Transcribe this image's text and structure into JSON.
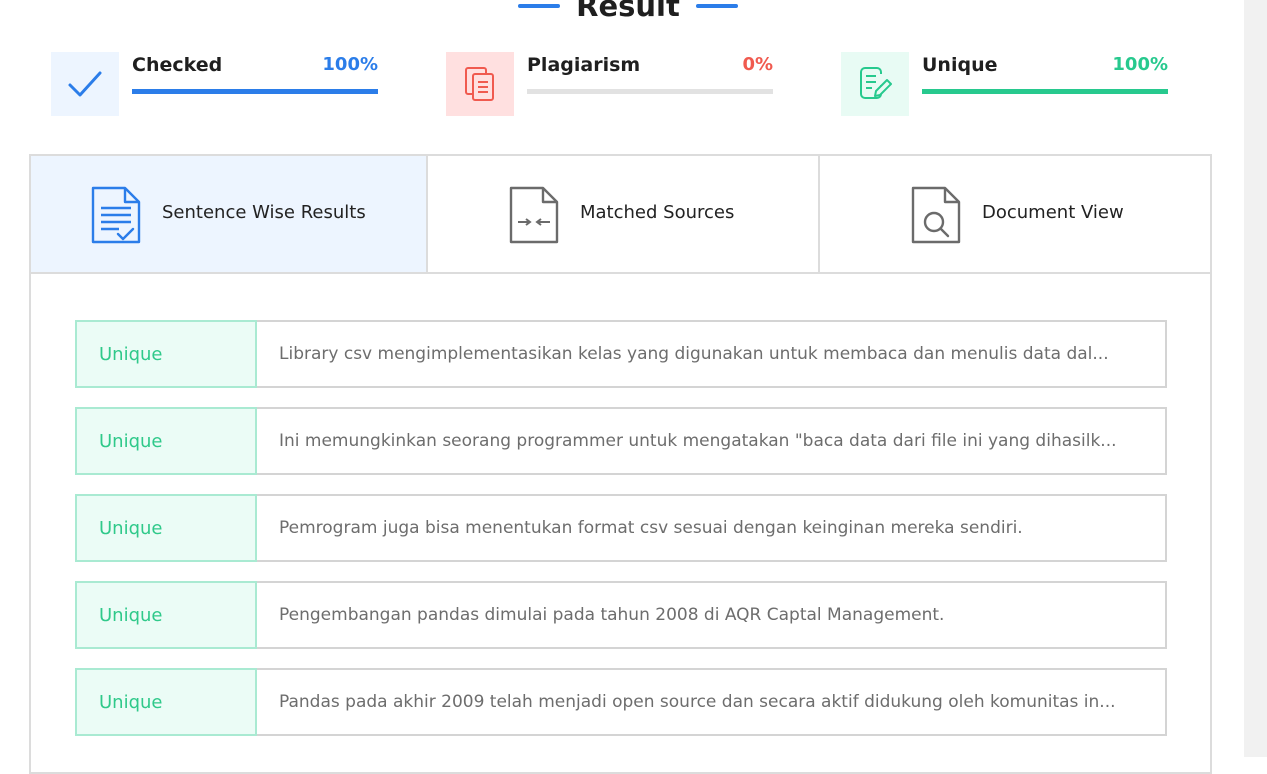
{
  "header": {
    "title": "Result"
  },
  "colors": {
    "accent_blue": "#2b7de9",
    "plagiarism_red": "#f05a4f",
    "unique_green": "#27c98e"
  },
  "stats": [
    {
      "label": "Checked",
      "value": "100%",
      "fill_fraction": 1.0,
      "icon": "checkmark-icon"
    },
    {
      "label": "Plagiarism",
      "value": "0%",
      "fill_fraction": 0.0,
      "icon": "copy-documents-icon"
    },
    {
      "label": "Unique",
      "value": "100%",
      "fill_fraction": 1.0,
      "icon": "edit-document-icon"
    }
  ],
  "tabs": [
    {
      "label": "Sentence Wise Results",
      "icon": "document-check-icon",
      "active": true
    },
    {
      "label": "Matched Sources",
      "icon": "document-compare-icon",
      "active": false
    },
    {
      "label": "Document View",
      "icon": "document-search-icon",
      "active": false
    }
  ],
  "results": [
    {
      "status": "Unique",
      "text": "Library csv mengimplementasikan kelas yang digunakan untuk membaca dan menulis data dal..."
    },
    {
      "status": "Unique",
      "text": "Ini memungkinkan seorang programmer untuk mengatakan \"baca data dari file ini yang dihasilk..."
    },
    {
      "status": "Unique",
      "text": "Pemrogram juga bisa menentukan format csv sesuai dengan keinginan mereka sendiri."
    },
    {
      "status": "Unique",
      "text": "Pengembangan pandas dimulai pada tahun 2008 di AQR Captal Management."
    },
    {
      "status": "Unique",
      "text": "Pandas pada akhir 2009 telah menjadi open source dan secara aktif didukung oleh komunitas in..."
    }
  ]
}
